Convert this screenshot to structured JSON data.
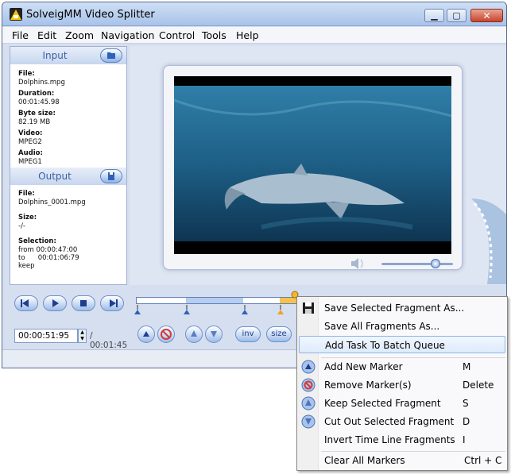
{
  "window": {
    "title": "SolveigMM Video Splitter",
    "min_glyph": "▁",
    "max_glyph": "▢",
    "close_glyph": "✕"
  },
  "menu": [
    "File",
    "Edit",
    "Zoom",
    "Navigation",
    "Control",
    "Tools",
    "Help"
  ],
  "input_panel": {
    "header": "Input",
    "fields": [
      {
        "label": "File:",
        "value": "Dolphins.mpg"
      },
      {
        "label": "Duration:",
        "value": "00:01:45.98"
      },
      {
        "label": "Byte size:",
        "value": "82.19 MB"
      },
      {
        "label": "Video:",
        "value": "MPEG2"
      },
      {
        "label": "Audio:",
        "value": "MPEG1"
      }
    ]
  },
  "output_panel": {
    "header": "Output",
    "file_label": "File:",
    "file_value": "Dolphins_0001.mpg",
    "size_label": "Size:",
    "size_value": "-/-",
    "selection_label": "Selection:",
    "selection_from": "from 00:00:47:00",
    "selection_to": "to      00:01:06:79",
    "selection_mode": "keep"
  },
  "playback": {
    "current_time": "00:00:51:95",
    "total_time": "/ 00:01:45"
  },
  "toolbar": {
    "inv_label": "inv",
    "size_label": "size"
  },
  "context_menu": {
    "items": [
      {
        "label": "Save Selected Fragment As...",
        "shortcut": "",
        "icon": "floppy-icon"
      },
      {
        "label": "Save All Fragments As...",
        "shortcut": "",
        "icon": ""
      },
      {
        "label": "Add Task To Batch Queue",
        "shortcut": "",
        "icon": ""
      },
      {
        "label": "Add New Marker",
        "shortcut": "M",
        "icon": "add-marker-icon"
      },
      {
        "label": "Remove Marker(s)",
        "shortcut": "Delete",
        "icon": "remove-marker-icon"
      },
      {
        "label": "Keep Selected Fragment",
        "shortcut": "S",
        "icon": "keep-fragment-icon"
      },
      {
        "label": "Cut Out Selected Fragment",
        "shortcut": "D",
        "icon": "cut-fragment-icon"
      },
      {
        "label": "Invert Time Line Fragments",
        "shortcut": "I",
        "icon": ""
      },
      {
        "label": "Clear All Markers",
        "shortcut": "Ctrl + C",
        "icon": ""
      }
    ]
  },
  "colors": {
    "accent": "#3b5ea8",
    "selection": "#f5c24a",
    "highlight": "#dcebfc"
  }
}
